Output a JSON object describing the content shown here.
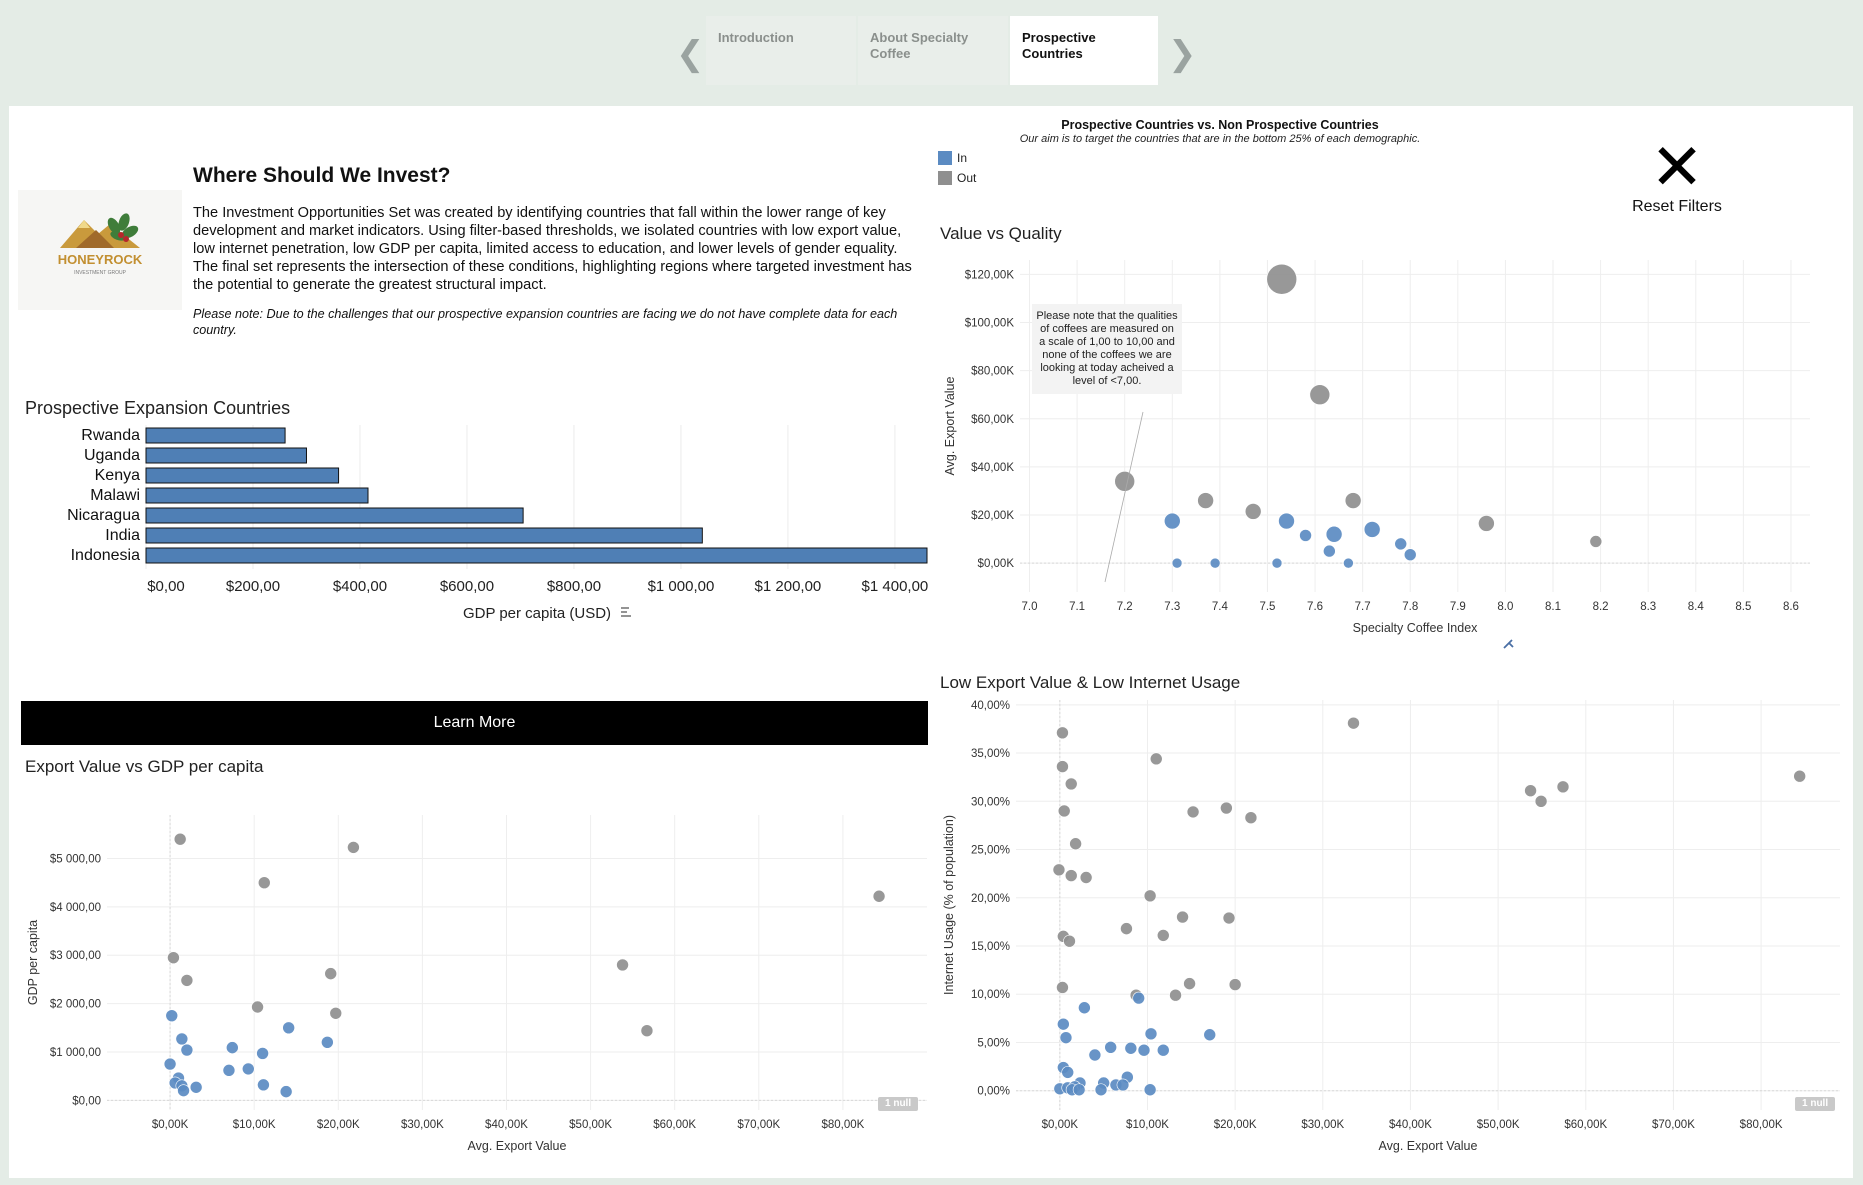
{
  "nav": {
    "tabs": [
      {
        "label": "Introduction",
        "active": false
      },
      {
        "label": "About Specialty Coffee",
        "active": false
      },
      {
        "label": "Prospective Countries",
        "active": true
      }
    ],
    "prev_icon": "chevron-left-icon",
    "next_icon": "chevron-right-icon"
  },
  "intro": {
    "logo_text": "HONEYROCK",
    "logo_subtext": "INVESTMENT GROUP",
    "heading": "Where Should We Invest?",
    "body": "The Investment Opportunities Set was created by identifying countries that fall within the lower range of key development and market indicators. Using filter-based thresholds, we isolated countries with low export value, low internet penetration, low GDP per capita, limited access to education, and lower levels of gender equality. The final set represents the intersection of these conditions, highlighting regions where targeted investment has the potential to generate the greatest structural impact.",
    "note": "Please note: Due to the challenges that our prospective expansion countries are facing we do not have complete data for each country."
  },
  "learn_more_label": "Learn More",
  "legend": {
    "title": "Prospective Countries vs. Non Prospective Countries",
    "subtitle": "Our aim is to target the countries that are in the bottom 25% of each demographic.",
    "items": [
      {
        "label": "In",
        "color": "#5b8bc2"
      },
      {
        "label": "Out",
        "color": "#8f8f8f"
      }
    ]
  },
  "reset": {
    "icon": "close-icon",
    "label": "Reset Filters"
  },
  "colors": {
    "in": "#5b8bc2",
    "out": "#8f8f8f",
    "bar": "#4f7fb5"
  },
  "null_label": "1 null",
  "chart_data": [
    {
      "id": "expansion",
      "type": "bar",
      "title": "Prospective Expansion Countries",
      "xlabel": "GDP per capita (USD)",
      "categories": [
        "Rwanda",
        "Uganda",
        "Kenya",
        "Malawi",
        "Nicaragua",
        "India",
        "Indonesia"
      ],
      "values": [
        260,
        300,
        360,
        415,
        705,
        1040,
        1460
      ],
      "xlim": [
        0,
        1460
      ],
      "xticks": [
        0,
        200,
        400,
        600,
        800,
        1000,
        1200,
        1400
      ],
      "xtick_labels": [
        "$0,00",
        "$200,00",
        "$400,00",
        "$600,00",
        "$800,00",
        "$1 000,00",
        "$1 200,00",
        "$1 400,00"
      ]
    },
    {
      "id": "value_quality",
      "type": "scatter",
      "title": "Value vs Quality",
      "xlabel": "Specialty Coffee Index",
      "ylabel": "Avg. Export Value",
      "xlim": [
        6.98,
        8.64
      ],
      "ylim": [
        -12000,
        126000
      ],
      "xticks": [
        7.0,
        7.1,
        7.2,
        7.3,
        7.4,
        7.5,
        7.6,
        7.7,
        7.8,
        7.9,
        8.0,
        8.1,
        8.2,
        8.3,
        8.4,
        8.5,
        8.6
      ],
      "xtick_labels": [
        "7.0",
        "7.1",
        "7.2",
        "7.3",
        "7.4",
        "7.5",
        "7.6",
        "7.7",
        "7.8",
        "7.9",
        "8.0",
        "8.1",
        "8.2",
        "8.3",
        "8.4",
        "8.5",
        "8.6"
      ],
      "yticks": [
        0,
        20000,
        40000,
        60000,
        80000,
        100000,
        120000
      ],
      "ytick_labels": [
        "$0,00K",
        "$20,00K",
        "$40,00K",
        "$60,00K",
        "$80,00K",
        "$100,00K",
        "$120,00K"
      ],
      "annotation": "Please note that the qualities of coffees are measured on a scale of 1,00 to 10,00 and none of the coffees we are looking at today acheived a level of <7,00.",
      "points": [
        {
          "x": 7.53,
          "y": 118000,
          "size": 3,
          "group": "Out"
        },
        {
          "x": 7.61,
          "y": 70000,
          "size": 2,
          "group": "Out"
        },
        {
          "x": 7.2,
          "y": 34000,
          "size": 2,
          "group": "Out"
        },
        {
          "x": 7.37,
          "y": 26000,
          "size": 1,
          "group": "Out"
        },
        {
          "x": 7.47,
          "y": 21500,
          "size": 1,
          "group": "Out"
        },
        {
          "x": 7.68,
          "y": 26000,
          "size": 1,
          "group": "Out"
        },
        {
          "x": 7.96,
          "y": 16500,
          "size": 1,
          "group": "Out"
        },
        {
          "x": 8.19,
          "y": 9000,
          "size": 0,
          "group": "Out"
        },
        {
          "x": 7.3,
          "y": 17500,
          "size": 1,
          "group": "In"
        },
        {
          "x": 7.54,
          "y": 17500,
          "size": 1,
          "group": "In"
        },
        {
          "x": 7.58,
          "y": 11500,
          "size": 0,
          "group": "In"
        },
        {
          "x": 7.64,
          "y": 12000,
          "size": 1,
          "group": "In"
        },
        {
          "x": 7.63,
          "y": 5000,
          "size": 0,
          "group": "In"
        },
        {
          "x": 7.72,
          "y": 14000,
          "size": 1,
          "group": "In"
        },
        {
          "x": 7.78,
          "y": 8000,
          "size": 0,
          "group": "In"
        },
        {
          "x": 7.8,
          "y": 3500,
          "size": 0,
          "group": "In"
        },
        {
          "x": 7.31,
          "y": 0,
          "size": -1,
          "group": "In"
        },
        {
          "x": 7.39,
          "y": 0,
          "size": -1,
          "group": "In"
        },
        {
          "x": 7.52,
          "y": 0,
          "size": -1,
          "group": "In"
        },
        {
          "x": 7.67,
          "y": 0,
          "size": -1,
          "group": "In"
        }
      ]
    },
    {
      "id": "export_gdp",
      "type": "scatter",
      "title": "Export Value vs GDP per capita",
      "xlabel": "Avg. Export Value",
      "ylabel": "GDP per capita",
      "xlim": [
        -7500,
        90000
      ],
      "ylim": [
        -200,
        5900
      ],
      "xticks": [
        0,
        10000,
        20000,
        30000,
        40000,
        50000,
        60000,
        70000,
        80000
      ],
      "xtick_labels": [
        "$0,00K",
        "$10,00K",
        "$20,00K",
        "$30,00K",
        "$40,00K",
        "$50,00K",
        "$60,00K",
        "$70,00K",
        "$80,00K"
      ],
      "yticks": [
        0,
        1000,
        2000,
        3000,
        4000,
        5000
      ],
      "ytick_labels": [
        "$0,00",
        "$1 000,00",
        "$2 000,00",
        "$3 000,00",
        "$4 000,00",
        "$5 000,00"
      ],
      "points": [
        {
          "x": 1200,
          "y": 5400,
          "group": "Out"
        },
        {
          "x": 21800,
          "y": 5230,
          "group": "Out"
        },
        {
          "x": 11200,
          "y": 4500,
          "group": "Out"
        },
        {
          "x": 84300,
          "y": 4220,
          "group": "Out"
        },
        {
          "x": 400,
          "y": 2950,
          "group": "Out"
        },
        {
          "x": 2000,
          "y": 2480,
          "group": "Out"
        },
        {
          "x": 53800,
          "y": 2800,
          "group": "Out"
        },
        {
          "x": 19100,
          "y": 2620,
          "group": "Out"
        },
        {
          "x": 10400,
          "y": 1930,
          "group": "Out"
        },
        {
          "x": 19700,
          "y": 1800,
          "group": "Out"
        },
        {
          "x": 56700,
          "y": 1440,
          "group": "Out"
        },
        {
          "x": 200,
          "y": 1750,
          "group": "In"
        },
        {
          "x": 1400,
          "y": 1270,
          "group": "In"
        },
        {
          "x": 2000,
          "y": 1040,
          "group": "In"
        },
        {
          "x": 7400,
          "y": 1090,
          "group": "In"
        },
        {
          "x": 11000,
          "y": 970,
          "group": "In"
        },
        {
          "x": 14100,
          "y": 1500,
          "group": "In"
        },
        {
          "x": 18700,
          "y": 1200,
          "group": "In"
        },
        {
          "x": 0,
          "y": 750,
          "group": "In"
        },
        {
          "x": 1000,
          "y": 460,
          "group": "In"
        },
        {
          "x": 600,
          "y": 360,
          "group": "In"
        },
        {
          "x": 1400,
          "y": 300,
          "group": "In"
        },
        {
          "x": 1600,
          "y": 200,
          "group": "In"
        },
        {
          "x": 3100,
          "y": 270,
          "group": "In"
        },
        {
          "x": 7000,
          "y": 620,
          "group": "In"
        },
        {
          "x": 9300,
          "y": 650,
          "group": "In"
        },
        {
          "x": 11100,
          "y": 320,
          "group": "In"
        },
        {
          "x": 13800,
          "y": 180,
          "group": "In"
        }
      ]
    },
    {
      "id": "export_internet",
      "type": "scatter",
      "title": "Low Export Value & Low Internet Usage",
      "xlabel": "Avg. Export Value",
      "ylabel": "Internet Usage (% of population)",
      "xlim": [
        -5000,
        89000
      ],
      "ylim": [
        -2.0,
        40.5
      ],
      "xticks": [
        0,
        10000,
        20000,
        30000,
        40000,
        50000,
        60000,
        70000,
        80000
      ],
      "xtick_labels": [
        "$0,00K",
        "$10,00K",
        "$20,00K",
        "$30,00K",
        "$40,00K",
        "$50,00K",
        "$60,00K",
        "$70,00K",
        "$80,00K"
      ],
      "yticks": [
        0,
        5,
        10,
        15,
        20,
        25,
        30,
        35,
        40
      ],
      "ytick_labels": [
        "0,00%",
        "5,00%",
        "10,00%",
        "15,00%",
        "20,00%",
        "25,00%",
        "30,00%",
        "35,00%",
        "40,00%"
      ],
      "points": [
        {
          "x": 33500,
          "y": 38.1,
          "group": "Out"
        },
        {
          "x": 300,
          "y": 37.1,
          "group": "Out"
        },
        {
          "x": 11000,
          "y": 34.4,
          "group": "Out"
        },
        {
          "x": 300,
          "y": 33.6,
          "group": "Out"
        },
        {
          "x": 1300,
          "y": 31.8,
          "group": "Out"
        },
        {
          "x": 53700,
          "y": 31.1,
          "group": "Out"
        },
        {
          "x": 57400,
          "y": 31.5,
          "group": "Out"
        },
        {
          "x": 54900,
          "y": 30.0,
          "group": "Out"
        },
        {
          "x": 84400,
          "y": 32.6,
          "group": "Out"
        },
        {
          "x": 500,
          "y": 29.0,
          "group": "Out"
        },
        {
          "x": 19000,
          "y": 29.3,
          "group": "Out"
        },
        {
          "x": 15200,
          "y": 28.9,
          "group": "Out"
        },
        {
          "x": 21800,
          "y": 28.3,
          "group": "Out"
        },
        {
          "x": 1800,
          "y": 25.6,
          "group": "Out"
        },
        {
          "x": -100,
          "y": 22.9,
          "group": "Out"
        },
        {
          "x": 1300,
          "y": 22.3,
          "group": "Out"
        },
        {
          "x": 3000,
          "y": 22.1,
          "group": "Out"
        },
        {
          "x": 10300,
          "y": 20.2,
          "group": "Out"
        },
        {
          "x": 14000,
          "y": 18.0,
          "group": "Out"
        },
        {
          "x": 19300,
          "y": 17.9,
          "group": "Out"
        },
        {
          "x": 7600,
          "y": 16.8,
          "group": "Out"
        },
        {
          "x": 11800,
          "y": 16.1,
          "group": "Out"
        },
        {
          "x": 400,
          "y": 16.0,
          "group": "Out"
        },
        {
          "x": 1100,
          "y": 15.5,
          "group": "Out"
        },
        {
          "x": 14800,
          "y": 11.1,
          "group": "Out"
        },
        {
          "x": 20000,
          "y": 11.0,
          "group": "Out"
        },
        {
          "x": 300,
          "y": 10.7,
          "group": "Out"
        },
        {
          "x": 8700,
          "y": 9.9,
          "group": "Out"
        },
        {
          "x": 13200,
          "y": 9.9,
          "group": "Out"
        },
        {
          "x": 2800,
          "y": 8.6,
          "group": "In"
        },
        {
          "x": 9000,
          "y": 9.6,
          "group": "In"
        },
        {
          "x": 400,
          "y": 6.9,
          "group": "In"
        },
        {
          "x": 17100,
          "y": 5.8,
          "group": "In"
        },
        {
          "x": 700,
          "y": 5.5,
          "group": "In"
        },
        {
          "x": 10400,
          "y": 5.9,
          "group": "In"
        },
        {
          "x": 5800,
          "y": 4.5,
          "group": "In"
        },
        {
          "x": 8100,
          "y": 4.4,
          "group": "In"
        },
        {
          "x": 9600,
          "y": 4.2,
          "group": "In"
        },
        {
          "x": 11800,
          "y": 4.2,
          "group": "In"
        },
        {
          "x": 4000,
          "y": 3.7,
          "group": "In"
        },
        {
          "x": 400,
          "y": 2.4,
          "group": "In"
        },
        {
          "x": 900,
          "y": 1.9,
          "group": "In"
        },
        {
          "x": 7700,
          "y": 1.4,
          "group": "In"
        },
        {
          "x": 2300,
          "y": 0.8,
          "group": "In"
        },
        {
          "x": 5000,
          "y": 0.8,
          "group": "In"
        },
        {
          "x": 6400,
          "y": 0.6,
          "group": "In"
        },
        {
          "x": 7200,
          "y": 0.6,
          "group": "In"
        },
        {
          "x": 0,
          "y": 0.2,
          "group": "In"
        },
        {
          "x": 900,
          "y": 0.3,
          "group": "In"
        },
        {
          "x": 1700,
          "y": 0.4,
          "group": "In"
        },
        {
          "x": 1400,
          "y": 0.1,
          "group": "In"
        },
        {
          "x": 2200,
          "y": 0.1,
          "group": "In"
        },
        {
          "x": 4700,
          "y": 0.1,
          "group": "In"
        },
        {
          "x": 10300,
          "y": 0.1,
          "group": "In"
        }
      ]
    }
  ]
}
